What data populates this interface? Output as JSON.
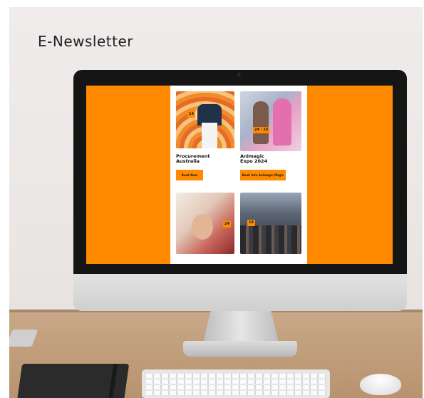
{
  "header": {
    "title": "E-Newsletter"
  },
  "newsletter": {
    "events": [
      {
        "title": "Procurement\nAustralia",
        "badge": "14",
        "button_label": "Book Now"
      },
      {
        "title": "Animagic\nExpo 2024",
        "badge": "24 · 25",
        "button_label": "Book Into Animagic Magic"
      },
      {
        "badge": "24"
      },
      {
        "badge": "14"
      }
    ]
  },
  "colors": {
    "accent": "#ff8a00",
    "screen_bg": "#ff8a00",
    "bezel": "#151515",
    "wall": "#eae6e4",
    "desk": "#c29f7d"
  },
  "icons": [
    "monitor-icon",
    "keyboard-icon",
    "mouse-icon",
    "notebook-icon"
  ]
}
